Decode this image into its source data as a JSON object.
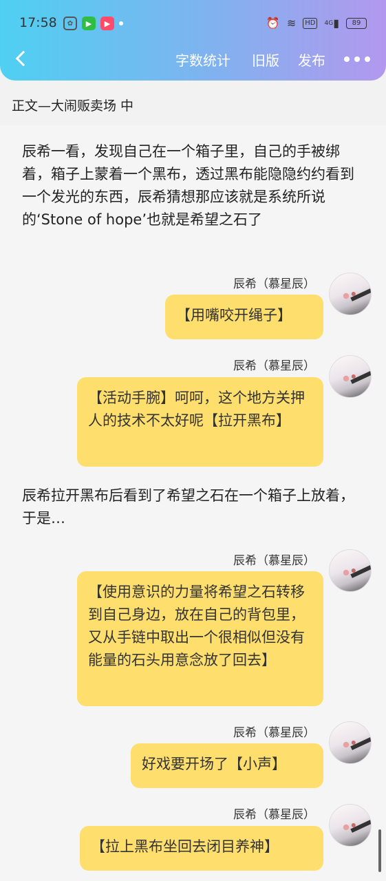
{
  "status_bar": {
    "time": "17:58",
    "app_icons": [
      "baidu-icon",
      "iqiyi-icon",
      "video-app-icon"
    ],
    "battery": "89",
    "network": "4G"
  },
  "nav": {
    "word_count": "字数统计",
    "old_version": "旧版",
    "publish": "发布"
  },
  "chapter_title": "正文—大闹贩卖场 中",
  "messages": [
    {
      "type": "narration",
      "text": "辰希一看，发现自己在一个箱子里，自己的手被绑着，箱子上蒙着一个黑布，透过黑布能隐隐约约看到一个发光的东西，辰希猜想那应该就是系统所说的‘Stone of hope’也就是希望之石了"
    },
    {
      "type": "bubble",
      "speaker": "辰希（慕星辰）",
      "text": "【用嘴咬开绳子】"
    },
    {
      "type": "bubble",
      "speaker": "辰希（慕星辰）",
      "text": "【活动手腕】呵呵，这个地方关押人的技术不太好呢【拉开黑布】"
    },
    {
      "type": "narration",
      "text": "辰希拉开黑布后看到了希望之石在一个箱子上放着，于是…"
    },
    {
      "type": "bubble",
      "speaker": "辰希（慕星辰）",
      "text": "【使用意识的力量将希望之石转移到自己身边，放在自己的背包里，又从手链中取出一个很相似但没有能量的石头用意念放了回去】"
    },
    {
      "type": "bubble",
      "speaker": "辰希（慕星辰）",
      "text": "好戏要开场了【小声】"
    },
    {
      "type": "bubble",
      "speaker": "辰希（慕星辰）",
      "text": "【拉上黑布坐回去闭目养神】"
    }
  ],
  "colors": {
    "header_gradient_start": "#4fd0f2",
    "header_gradient_end": "#b298ee",
    "bubble": "#fede6c",
    "background": "#f5f5f5"
  }
}
